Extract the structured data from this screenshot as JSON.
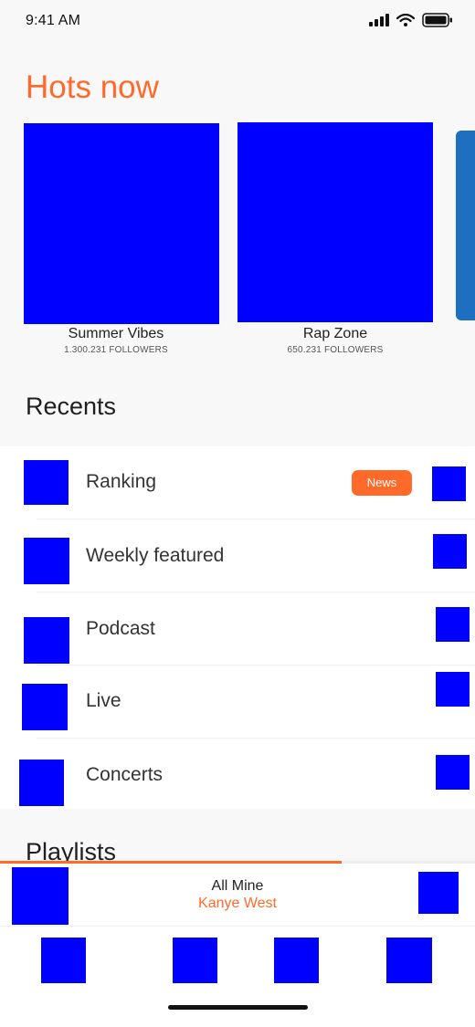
{
  "status_bar": {
    "time": "9:41 AM",
    "icons": [
      "signal-icon",
      "wifi-icon",
      "battery-icon"
    ]
  },
  "hots": {
    "title": "Hots now",
    "cards": [
      {
        "name": "Summer Vibes",
        "followers": "1.300.231 FOLLOWERS"
      },
      {
        "name": "Rap Zone",
        "followers": "650.231 FOLLOWERS"
      }
    ]
  },
  "recents": {
    "title": "Recents",
    "items": [
      {
        "label": "Ranking",
        "badge": "News"
      },
      {
        "label": "Weekly featured"
      },
      {
        "label": "Podcast"
      },
      {
        "label": "Live"
      },
      {
        "label": "Concerts"
      }
    ]
  },
  "playlists": {
    "title": "Playlists"
  },
  "now_playing": {
    "title": "All Mine",
    "artist": "Kanye West",
    "progress": 0.72
  },
  "colors": {
    "accent": "#ff6a2b",
    "placeholder": "#0000ff",
    "background": "#f8f8f8"
  }
}
